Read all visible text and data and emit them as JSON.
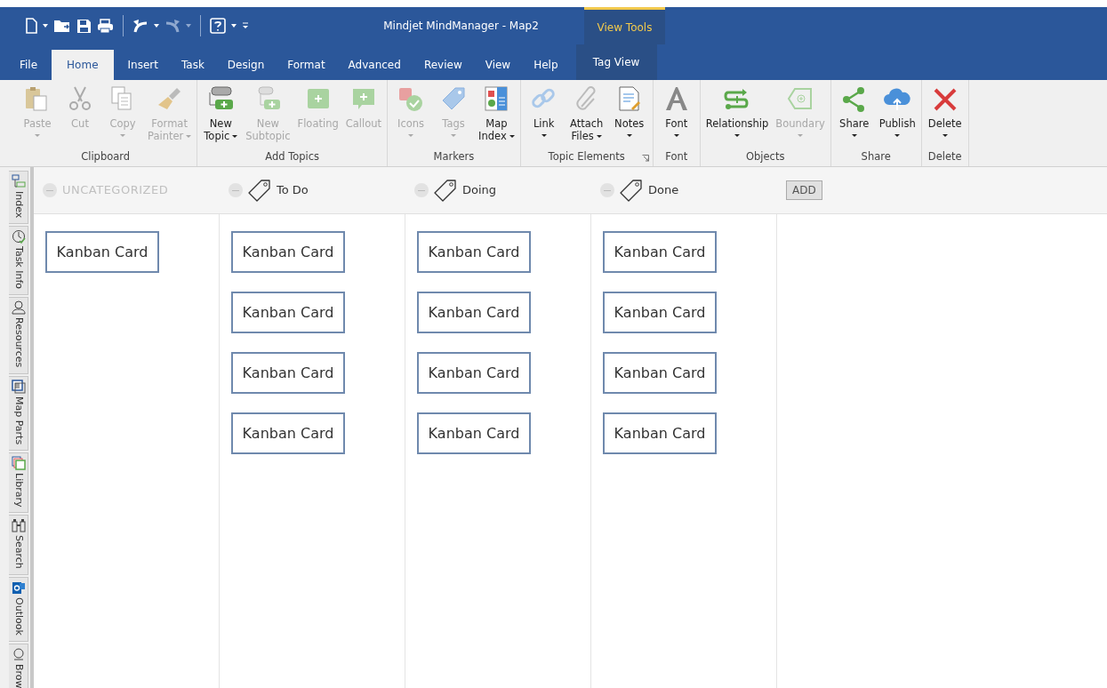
{
  "window": {
    "title": "Mindjet MindManager - Map2",
    "context_group": "View Tools"
  },
  "ribbon_tabs": [
    {
      "label": "File",
      "selected": false,
      "kind": "file"
    },
    {
      "label": "Home",
      "selected": true,
      "kind": "normal"
    },
    {
      "label": "Insert",
      "selected": false,
      "kind": "normal"
    },
    {
      "label": "Task",
      "selected": false,
      "kind": "normal"
    },
    {
      "label": "Design",
      "selected": false,
      "kind": "normal"
    },
    {
      "label": "Format",
      "selected": false,
      "kind": "normal"
    },
    {
      "label": "Advanced",
      "selected": false,
      "kind": "normal"
    },
    {
      "label": "Review",
      "selected": false,
      "kind": "normal"
    },
    {
      "label": "View",
      "selected": false,
      "kind": "normal"
    },
    {
      "label": "Help",
      "selected": false,
      "kind": "normal"
    },
    {
      "label": "Tag View",
      "selected": false,
      "kind": "context"
    }
  ],
  "ribbon_groups": [
    {
      "label": "Clipboard",
      "buttons": [
        {
          "label": "Paste",
          "disabled": true,
          "dropdown": true
        },
        {
          "label": "Cut",
          "disabled": true
        },
        {
          "label": "Copy",
          "disabled": true,
          "dropdown": true
        },
        {
          "label": "Format\nPainter",
          "disabled": true,
          "dropdown": true
        }
      ]
    },
    {
      "label": "Add Topics",
      "buttons": [
        {
          "label": "New\nTopic",
          "disabled": false,
          "dropdown": true
        },
        {
          "label": "New\nSubtopic",
          "disabled": true
        },
        {
          "label": "Floating",
          "disabled": true
        },
        {
          "label": "Callout",
          "disabled": true
        }
      ]
    },
    {
      "label": "Markers",
      "buttons": [
        {
          "label": "Icons",
          "disabled": true,
          "dropdown": true
        },
        {
          "label": "Tags",
          "disabled": true,
          "dropdown": true
        },
        {
          "label": "Map\nIndex",
          "disabled": false,
          "dropdown": true
        }
      ]
    },
    {
      "label": "Topic Elements",
      "launcher": true,
      "buttons": [
        {
          "label": "Link",
          "disabled": false,
          "dropdown": true
        },
        {
          "label": "Attach\nFiles",
          "disabled": false,
          "dropdown": true
        },
        {
          "label": "Notes",
          "disabled": false,
          "dropdown": true
        }
      ]
    },
    {
      "label": "Font",
      "buttons": [
        {
          "label": "Font",
          "disabled": false,
          "dropdown": true
        }
      ]
    },
    {
      "label": "Objects",
      "buttons": [
        {
          "label": "Relationship",
          "disabled": false,
          "dropdown": true
        },
        {
          "label": "Boundary",
          "disabled": true,
          "dropdown": true
        }
      ]
    },
    {
      "label": "Share",
      "buttons": [
        {
          "label": "Share",
          "disabled": false,
          "dropdown": true
        },
        {
          "label": "Publish",
          "disabled": false,
          "dropdown": true
        }
      ]
    },
    {
      "label": "Delete",
      "buttons": [
        {
          "label": "Delete",
          "disabled": false,
          "dropdown": true
        }
      ]
    }
  ],
  "side_tabs": [
    {
      "label": "Index"
    },
    {
      "label": "Task Info"
    },
    {
      "label": "Resources"
    },
    {
      "label": "Map Parts"
    },
    {
      "label": "Library"
    },
    {
      "label": "Search"
    },
    {
      "label": "Outlook"
    },
    {
      "label": "Brow"
    }
  ],
  "board": {
    "columns": [
      {
        "title": "UNCATEGORIZED",
        "kind": "uncategorized",
        "cards": [
          "Kanban Card"
        ]
      },
      {
        "title": "To Do",
        "kind": "tag",
        "cards": [
          "Kanban Card",
          "Kanban Card",
          "Kanban Card",
          "Kanban Card"
        ]
      },
      {
        "title": "Doing",
        "kind": "tag",
        "cards": [
          "Kanban Card",
          "Kanban Card",
          "Kanban Card",
          "Kanban Card"
        ]
      },
      {
        "title": "Done",
        "kind": "tag",
        "cards": [
          "Kanban Card",
          "Kanban Card",
          "Kanban Card",
          "Kanban Card"
        ]
      }
    ],
    "add_button": "ADD"
  }
}
